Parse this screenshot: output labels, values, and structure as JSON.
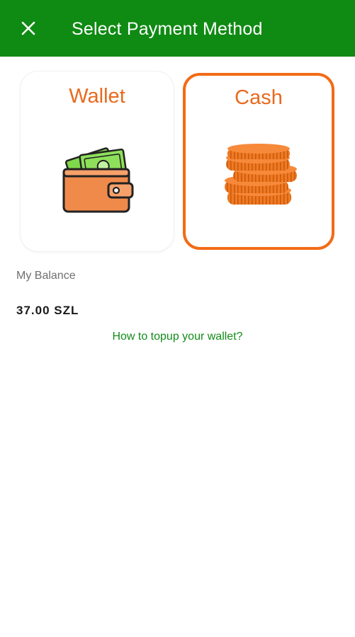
{
  "appbar": {
    "title": "Select Payment Method",
    "close_icon": "close-icon",
    "background_color": "#0f8a13"
  },
  "payment_methods": [
    {
      "label": "Wallet",
      "icon": "wallet-icon",
      "selected": false
    },
    {
      "label": "Cash",
      "icon": "coins-icon",
      "selected": true
    }
  ],
  "accent_color": "#f26b16",
  "balance": {
    "label": "My Balance",
    "value": "37.00 SZL"
  },
  "topup_link": "How to topup your wallet?"
}
